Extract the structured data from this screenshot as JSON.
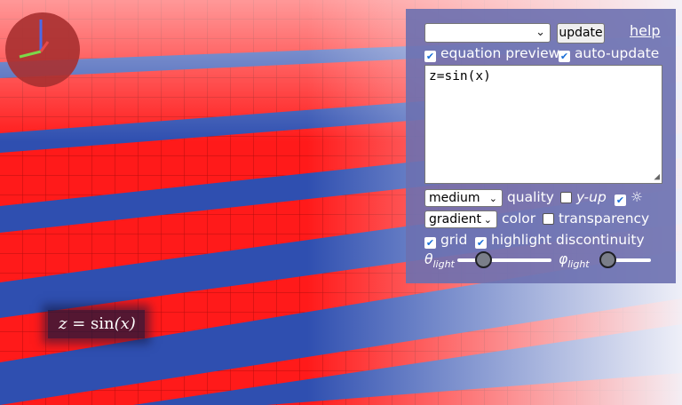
{
  "controls": {
    "preset_select_value": "",
    "update_label": "update",
    "help_label": "help",
    "equation_preview_label": "equation preview",
    "equation_preview_checked": true,
    "auto_update_label": "auto-update",
    "auto_update_checked": true,
    "equation_text": "z=sin(x)",
    "quality_value": "medium",
    "quality_label": "quality",
    "yup_label": "y-up",
    "yup_checked": false,
    "light_checked": true,
    "light_icon": "sun-icon",
    "color_mode_value": "gradient",
    "color_label": "color",
    "transparency_label": "transparency",
    "transparency_checked": false,
    "grid_label": "grid",
    "grid_checked": true,
    "highlight_label": "highlight discontinuity",
    "highlight_checked": true,
    "theta_symbol": "θ",
    "phi_symbol": "φ",
    "light_subscript": "light",
    "theta_light_fraction": 0.27,
    "phi_light_fraction": 0.0
  },
  "formula_overlay": {
    "lhs": "z",
    "eq": " = ",
    "fn": "sin",
    "arg": "(x)"
  },
  "colors": {
    "surface_red": "#ff1a1a",
    "surface_blue": "#2f4fb0",
    "panel_bg": "#6c70b0",
    "axis_x": "#e84a4a",
    "axis_y": "#7cd84a",
    "axis_z": "#4a6ae8"
  }
}
